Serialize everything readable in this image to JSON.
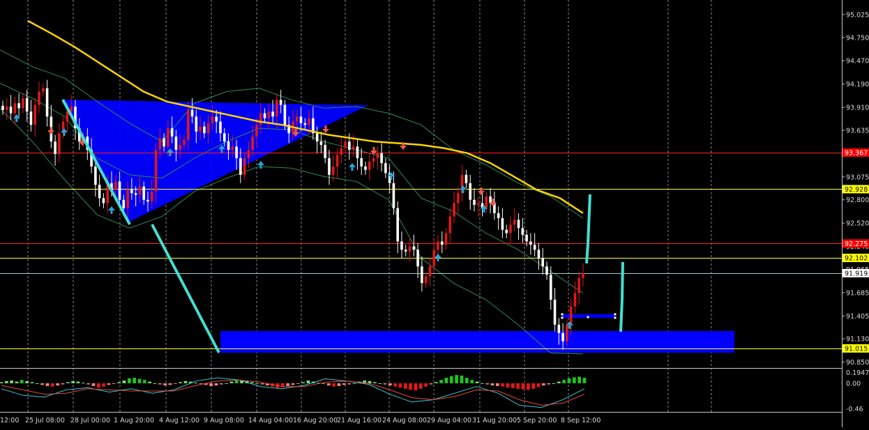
{
  "chart_data": {
    "type": "candlestick",
    "title": "",
    "price_axis": {
      "ylim": [
        90.78,
        95.2
      ],
      "ticks": [
        "95.025",
        "94.750",
        "94.470",
        "94.190",
        "93.910",
        "93.635",
        "93.355",
        "93.075",
        "92.800",
        "92.520",
        "92.240",
        "91.965",
        "91.685",
        "91.405",
        "91.130",
        "90.850"
      ]
    },
    "time_axis": {
      "labels": [
        "12:00",
        "25 Jul 08:00",
        "28 Jul 00:00",
        "1 Aug 20:00",
        "4 Aug 12:00",
        "9 Aug 08:00",
        "14 Aug 04:00",
        "16 Aug 20:00",
        "21 Aug 16:00",
        "24 Aug 08:00",
        "29 Aug 04:00",
        "31 Aug 20:00",
        "5 Sep 20:00",
        "8 Sep 12:00"
      ]
    },
    "price_labels": [
      {
        "value": 93.367,
        "text": "93.367",
        "bg": "#ff0000",
        "fg": "#ffffff"
      },
      {
        "value": 92.928,
        "text": "92.928",
        "bg": "#ffff00",
        "fg": "#000000"
      },
      {
        "value": 92.275,
        "text": "92.275",
        "bg": "#ff0000",
        "fg": "#ffffff"
      },
      {
        "value": 92.102,
        "text": "92.102",
        "bg": "#ffff00",
        "fg": "#000000"
      },
      {
        "value": 91.919,
        "text": "91.919",
        "bg": "#ffffff",
        "fg": "#000000"
      },
      {
        "value": 91.015,
        "text": "91.015",
        "bg": "#ffff00",
        "fg": "#000000"
      }
    ],
    "horizontal_lines": [
      {
        "value": 93.367,
        "color": "#ff2020"
      },
      {
        "value": 92.928,
        "color": "#ffff40"
      },
      {
        "value": 92.275,
        "color": "#ff2020"
      },
      {
        "value": 92.102,
        "color": "#ffff40"
      },
      {
        "value": 91.919,
        "color": "#a0d0d0"
      },
      {
        "value": 91.015,
        "color": "#ffff40"
      }
    ],
    "closes": [
      93.88,
      93.92,
      93.84,
      93.96,
      93.9,
      94.02,
      93.86,
      93.7,
      93.94,
      94.1,
      94.14,
      93.8,
      93.5,
      93.35,
      93.6,
      93.74,
      93.86,
      93.92,
      93.66,
      93.5,
      93.56,
      93.4,
      93.2,
      92.98,
      92.82,
      92.76,
      93.0,
      92.92,
      93.02,
      92.8,
      92.7,
      92.92,
      92.88,
      92.86,
      92.96,
      92.8,
      92.78,
      92.9,
      93.4,
      93.54,
      93.44,
      93.66,
      93.56,
      93.4,
      93.46,
      93.52,
      93.88,
      93.8,
      93.62,
      93.68,
      93.6,
      93.72,
      93.8,
      93.74,
      93.6,
      93.5,
      93.4,
      93.44,
      93.3,
      93.1,
      93.3,
      93.4,
      93.56,
      93.7,
      93.84,
      93.78,
      93.86,
      93.8,
      94.0,
      93.94,
      93.7,
      93.6,
      93.74,
      93.8,
      93.72,
      93.7,
      93.78,
      93.6,
      93.5,
      93.46,
      93.3,
      93.1,
      93.2,
      93.34,
      93.42,
      93.5,
      93.4,
      93.44,
      93.3,
      93.2,
      93.16,
      93.26,
      93.3,
      93.36,
      93.24,
      93.12,
      93.0,
      92.7,
      92.3,
      92.2,
      92.18,
      92.24,
      92.2,
      92.0,
      91.8,
      91.88,
      92.0,
      92.2,
      92.3,
      92.26,
      92.4,
      92.6,
      92.76,
      92.88,
      93.1,
      93.0,
      92.8,
      92.74,
      92.76,
      92.7,
      92.84,
      92.76,
      92.64,
      92.58,
      92.44,
      92.4,
      92.5,
      92.56,
      92.46,
      92.38,
      92.3,
      92.26,
      92.2,
      92.1,
      92.0,
      91.9,
      91.6,
      91.3,
      91.2,
      91.1,
      91.3,
      91.52,
      91.68,
      91.86,
      91.92
    ],
    "sma_values": [
      94.95,
      94.8,
      94.64,
      94.46,
      94.28,
      94.1,
      93.98,
      93.92,
      93.86,
      93.8,
      93.74,
      93.7,
      93.64,
      93.58,
      93.54,
      93.5,
      93.48,
      93.46,
      93.42,
      93.36,
      93.24,
      93.08,
      92.92,
      92.82,
      92.64
    ],
    "bands": {
      "upper": [
        94.6,
        94.4,
        94.26,
        93.98,
        93.72,
        93.5,
        93.96,
        94.1,
        94.14,
        94.0,
        93.9,
        93.92,
        93.84,
        93.7,
        93.4,
        93.22,
        93.0,
        92.84,
        92.58
      ],
      "middle": [
        94.2,
        94.02,
        93.8,
        93.3,
        93.1,
        93.06,
        93.3,
        93.5,
        93.66,
        93.64,
        93.5,
        93.4,
        93.3,
        92.82,
        92.66,
        92.4,
        92.2,
        91.94,
        91.68
      ],
      "lower": [
        93.9,
        93.5,
        93.04,
        92.62,
        92.46,
        92.6,
        92.9,
        93.06,
        93.2,
        93.18,
        93.08,
        93.02,
        92.8,
        92.1,
        91.8,
        91.6,
        91.3,
        90.96,
        90.95
      ]
    },
    "macd": {
      "ylim": [
        -0.52,
        0.24
      ],
      "ticks": [
        "0.1947",
        "0.00",
        "-0.46"
      ],
      "histogram": [
        0.02,
        0.04,
        0.05,
        0.03,
        0.06,
        0.04,
        0.02,
        0.0,
        -0.03,
        -0.05,
        -0.06,
        -0.04,
        -0.02,
        0.02,
        0.04,
        0.03,
        0.01,
        -0.02,
        -0.05,
        -0.08,
        -0.06,
        -0.03,
        -0.01,
        0.02,
        0.05,
        0.09,
        0.1,
        0.08,
        0.06,
        0.03,
        0.0,
        -0.02,
        -0.04,
        -0.03,
        -0.01,
        0.02,
        0.04,
        0.03,
        0.01,
        -0.01,
        -0.03,
        -0.05,
        -0.04,
        -0.02,
        0.0,
        0.03,
        0.06,
        0.05,
        0.04,
        0.02,
        0.0,
        -0.02,
        -0.04,
        -0.06,
        -0.08,
        -0.07,
        -0.05,
        -0.03,
        -0.01,
        0.02,
        0.05,
        0.03,
        0.01,
        -0.01,
        -0.04,
        -0.06,
        -0.05,
        -0.03,
        -0.02,
        0.0,
        0.03,
        0.05,
        0.04,
        0.02,
        0.0,
        -0.02,
        -0.04,
        -0.06,
        -0.08,
        -0.1,
        -0.12,
        -0.13,
        -0.1,
        -0.06,
        -0.02,
        0.02,
        0.06,
        0.1,
        0.13,
        0.15,
        0.14,
        0.1,
        0.06,
        0.03,
        0.0,
        -0.02,
        -0.04,
        -0.05,
        -0.06,
        -0.08,
        -0.09,
        -0.1,
        -0.11,
        -0.12,
        -0.1,
        -0.07,
        -0.04,
        -0.02,
        0.0,
        0.03,
        0.06,
        0.09,
        0.11,
        0.12,
        0.1
      ],
      "line_cyan": [
        -0.1,
        -0.22,
        -0.25,
        -0.12,
        -0.08,
        -0.16,
        -0.1,
        -0.18,
        -0.12,
        0.04,
        0.1,
        0.06,
        -0.06,
        -0.1,
        -0.04,
        0.08,
        0.04,
        -0.02,
        -0.2,
        -0.34,
        -0.3,
        -0.18,
        -0.06,
        -0.18,
        -0.4,
        -0.44,
        -0.3,
        -0.1
      ],
      "line_red": [
        -0.04,
        -0.12,
        -0.2,
        -0.18,
        -0.1,
        -0.12,
        -0.14,
        -0.14,
        -0.14,
        -0.04,
        0.04,
        0.06,
        0.02,
        -0.06,
        -0.06,
        0.02,
        0.04,
        0.0,
        -0.12,
        -0.26,
        -0.3,
        -0.24,
        -0.12,
        -0.14,
        -0.3,
        -0.4,
        -0.36,
        -0.2
      ]
    }
  }
}
